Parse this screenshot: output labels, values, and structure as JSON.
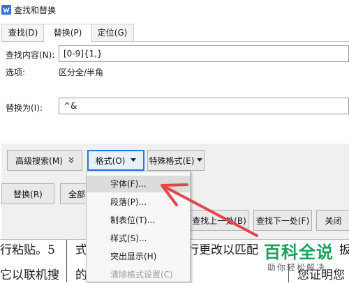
{
  "window": {
    "title": "查找和替换"
  },
  "tabs": [
    {
      "label": "查找(D)"
    },
    {
      "label": "替换(P)"
    },
    {
      "label": "定位(G)"
    }
  ],
  "find": {
    "label": "查找内容(N):",
    "value": "[0-9]{1,}"
  },
  "options": {
    "label": "选项:",
    "value": "区分全/半角"
  },
  "replace": {
    "label": "替换为(I):",
    "value": "^&"
  },
  "buttons": {
    "advanced": "高级搜索(M)",
    "format": "格式(O)",
    "special": "特殊格式(E)",
    "replace": "替换(R)",
    "replace_all": "全部替",
    "find_prev": "查找上一处(B)",
    "find_next": "查找下一处(F)",
    "close": "关闭"
  },
  "format_menu": [
    {
      "label": "字体(F)..."
    },
    {
      "label": "段落(P)..."
    },
    {
      "label": "制表位(T)..."
    },
    {
      "label": "样式(S)..."
    },
    {
      "label": "突出显示(H)"
    },
    {
      "label": "清除格式设置(C)"
    }
  ],
  "document": {
    "row1": [
      "行粘贴。5",
      "式",
      "行更改以匹配",
      "扳"
    ],
    "row2": [
      "它以联机搜",
      "的",
      "您证明您"
    ]
  },
  "watermark": {
    "brand": "百科全说",
    "tagline": "助你轻松解决"
  },
  "colors": {
    "accent": "#2b74d9",
    "arrow": "#e0474c",
    "brand": "#1a9f5b"
  }
}
